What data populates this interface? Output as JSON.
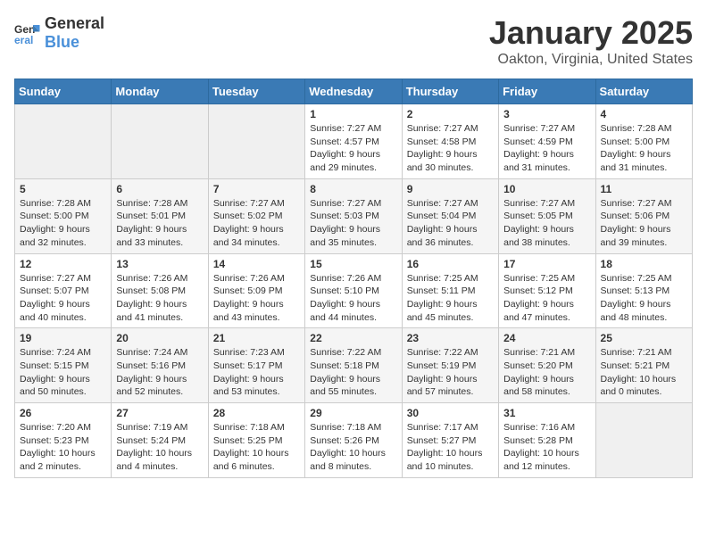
{
  "header": {
    "logo_general": "General",
    "logo_blue": "Blue",
    "title": "January 2025",
    "subtitle": "Oakton, Virginia, United States"
  },
  "weekdays": [
    "Sunday",
    "Monday",
    "Tuesday",
    "Wednesday",
    "Thursday",
    "Friday",
    "Saturday"
  ],
  "weeks": [
    [
      {
        "day": "",
        "info": ""
      },
      {
        "day": "",
        "info": ""
      },
      {
        "day": "",
        "info": ""
      },
      {
        "day": "1",
        "info": "Sunrise: 7:27 AM\nSunset: 4:57 PM\nDaylight: 9 hours\nand 29 minutes."
      },
      {
        "day": "2",
        "info": "Sunrise: 7:27 AM\nSunset: 4:58 PM\nDaylight: 9 hours\nand 30 minutes."
      },
      {
        "day": "3",
        "info": "Sunrise: 7:27 AM\nSunset: 4:59 PM\nDaylight: 9 hours\nand 31 minutes."
      },
      {
        "day": "4",
        "info": "Sunrise: 7:28 AM\nSunset: 5:00 PM\nDaylight: 9 hours\nand 31 minutes."
      }
    ],
    [
      {
        "day": "5",
        "info": "Sunrise: 7:28 AM\nSunset: 5:00 PM\nDaylight: 9 hours\nand 32 minutes."
      },
      {
        "day": "6",
        "info": "Sunrise: 7:28 AM\nSunset: 5:01 PM\nDaylight: 9 hours\nand 33 minutes."
      },
      {
        "day": "7",
        "info": "Sunrise: 7:27 AM\nSunset: 5:02 PM\nDaylight: 9 hours\nand 34 minutes."
      },
      {
        "day": "8",
        "info": "Sunrise: 7:27 AM\nSunset: 5:03 PM\nDaylight: 9 hours\nand 35 minutes."
      },
      {
        "day": "9",
        "info": "Sunrise: 7:27 AM\nSunset: 5:04 PM\nDaylight: 9 hours\nand 36 minutes."
      },
      {
        "day": "10",
        "info": "Sunrise: 7:27 AM\nSunset: 5:05 PM\nDaylight: 9 hours\nand 38 minutes."
      },
      {
        "day": "11",
        "info": "Sunrise: 7:27 AM\nSunset: 5:06 PM\nDaylight: 9 hours\nand 39 minutes."
      }
    ],
    [
      {
        "day": "12",
        "info": "Sunrise: 7:27 AM\nSunset: 5:07 PM\nDaylight: 9 hours\nand 40 minutes."
      },
      {
        "day": "13",
        "info": "Sunrise: 7:26 AM\nSunset: 5:08 PM\nDaylight: 9 hours\nand 41 minutes."
      },
      {
        "day": "14",
        "info": "Sunrise: 7:26 AM\nSunset: 5:09 PM\nDaylight: 9 hours\nand 43 minutes."
      },
      {
        "day": "15",
        "info": "Sunrise: 7:26 AM\nSunset: 5:10 PM\nDaylight: 9 hours\nand 44 minutes."
      },
      {
        "day": "16",
        "info": "Sunrise: 7:25 AM\nSunset: 5:11 PM\nDaylight: 9 hours\nand 45 minutes."
      },
      {
        "day": "17",
        "info": "Sunrise: 7:25 AM\nSunset: 5:12 PM\nDaylight: 9 hours\nand 47 minutes."
      },
      {
        "day": "18",
        "info": "Sunrise: 7:25 AM\nSunset: 5:13 PM\nDaylight: 9 hours\nand 48 minutes."
      }
    ],
    [
      {
        "day": "19",
        "info": "Sunrise: 7:24 AM\nSunset: 5:15 PM\nDaylight: 9 hours\nand 50 minutes."
      },
      {
        "day": "20",
        "info": "Sunrise: 7:24 AM\nSunset: 5:16 PM\nDaylight: 9 hours\nand 52 minutes."
      },
      {
        "day": "21",
        "info": "Sunrise: 7:23 AM\nSunset: 5:17 PM\nDaylight: 9 hours\nand 53 minutes."
      },
      {
        "day": "22",
        "info": "Sunrise: 7:22 AM\nSunset: 5:18 PM\nDaylight: 9 hours\nand 55 minutes."
      },
      {
        "day": "23",
        "info": "Sunrise: 7:22 AM\nSunset: 5:19 PM\nDaylight: 9 hours\nand 57 minutes."
      },
      {
        "day": "24",
        "info": "Sunrise: 7:21 AM\nSunset: 5:20 PM\nDaylight: 9 hours\nand 58 minutes."
      },
      {
        "day": "25",
        "info": "Sunrise: 7:21 AM\nSunset: 5:21 PM\nDaylight: 10 hours\nand 0 minutes."
      }
    ],
    [
      {
        "day": "26",
        "info": "Sunrise: 7:20 AM\nSunset: 5:23 PM\nDaylight: 10 hours\nand 2 minutes."
      },
      {
        "day": "27",
        "info": "Sunrise: 7:19 AM\nSunset: 5:24 PM\nDaylight: 10 hours\nand 4 minutes."
      },
      {
        "day": "28",
        "info": "Sunrise: 7:18 AM\nSunset: 5:25 PM\nDaylight: 10 hours\nand 6 minutes."
      },
      {
        "day": "29",
        "info": "Sunrise: 7:18 AM\nSunset: 5:26 PM\nDaylight: 10 hours\nand 8 minutes."
      },
      {
        "day": "30",
        "info": "Sunrise: 7:17 AM\nSunset: 5:27 PM\nDaylight: 10 hours\nand 10 minutes."
      },
      {
        "day": "31",
        "info": "Sunrise: 7:16 AM\nSunset: 5:28 PM\nDaylight: 10 hours\nand 12 minutes."
      },
      {
        "day": "",
        "info": ""
      }
    ]
  ]
}
